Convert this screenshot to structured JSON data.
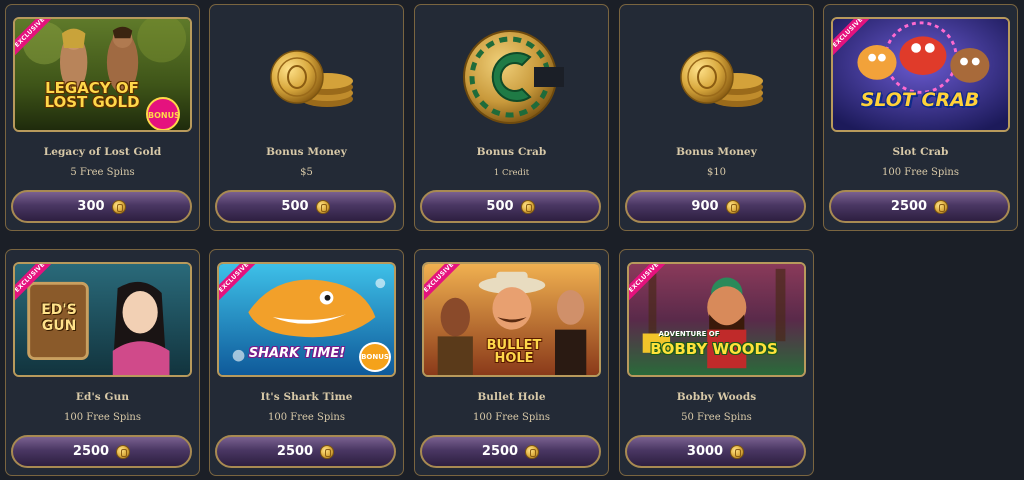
{
  "cards": [
    {
      "title": "Legacy of Lost Gold",
      "subtitle": "5 Free Spins",
      "price": "300",
      "badge": "EXCLUSIVE",
      "logo": "LEGACY OF LOST GOLD",
      "bonus_tag": "BONUS"
    },
    {
      "title": "Bonus Money",
      "subtitle": "$5",
      "price": "500"
    },
    {
      "title": "Bonus Crab",
      "subtitle": "1 Credit",
      "price": "500"
    },
    {
      "title": "Bonus Money",
      "subtitle": "$10",
      "price": "900"
    },
    {
      "title": "Slot Crab",
      "subtitle": "100 Free Spins",
      "price": "2500",
      "badge": "EXCLUSIVE",
      "logo": "SLOT CRAB"
    },
    {
      "title": "Ed's Gun",
      "subtitle": "100 Free Spins",
      "price": "2500",
      "badge": "EXCLUSIVE",
      "logo": "ED'S GUN"
    },
    {
      "title": "It's Shark Time",
      "subtitle": "100 Free Spins",
      "price": "2500",
      "badge": "EXCLUSIVE",
      "logo": "SHARK TIME!",
      "bonus_tag": "BONUS"
    },
    {
      "title": "Bullet Hole",
      "subtitle": "100 Free Spins",
      "price": "2500",
      "badge": "EXCLUSIVE",
      "logo": "BULLET HOLE"
    },
    {
      "title": "Bobby Woods",
      "subtitle": "50 Free Spins",
      "price": "3000",
      "badge": "EXCLUSIVE",
      "logo": "BOBBY WOODS",
      "logo_top": "ADVENTURE OF"
    }
  ],
  "colors": {
    "background": "#1b1f27",
    "card": "#232a36",
    "card_border": "#7a6540",
    "text": "#d8c9a8",
    "button_top": "#7a6190",
    "button_bottom": "#2d1f40",
    "exclusive_badge": "#e5127e"
  },
  "icons": {
    "price_icon": "gold-coin-icon",
    "bonus_money_image": "gold-coin-stack-icon",
    "bonus_crab_image": "crab-coin-icon"
  }
}
